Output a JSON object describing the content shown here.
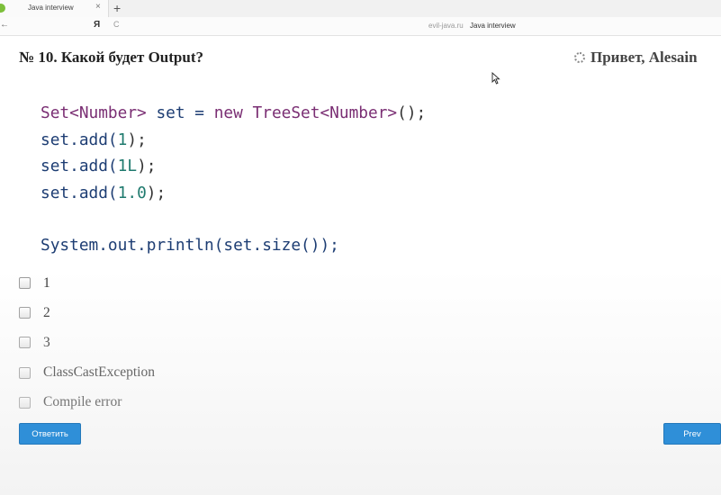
{
  "browser": {
    "tab_title": "Java interview",
    "tab_close": "×",
    "new_tab": "+",
    "back": "←",
    "yandex": "Я",
    "reload": "C",
    "url_domain": "evil-java.ru",
    "url_title": "Java interview"
  },
  "page": {
    "question_title": "№ 10. Какой будет Output?",
    "greeting": "Привет, Alesain"
  },
  "code": {
    "line1": {
      "type1": "Set<Number>",
      "var": " set = ",
      "kw": "new",
      "type2": " TreeSet<Number>",
      "end": "();"
    },
    "line2": {
      "pre": "set.add(",
      "num": "1",
      "end": ");"
    },
    "line3": {
      "pre": "set.add(",
      "num": "1L",
      "end": ");"
    },
    "line4": {
      "pre": "set.add(",
      "num": "1.0",
      "end": ");"
    },
    "line5": "System.out.println(set.size());"
  },
  "options": [
    "1",
    "2",
    "3",
    "ClassCastException",
    "Compile error"
  ],
  "buttons": {
    "answer": "Ответить",
    "prev": "Prev"
  }
}
